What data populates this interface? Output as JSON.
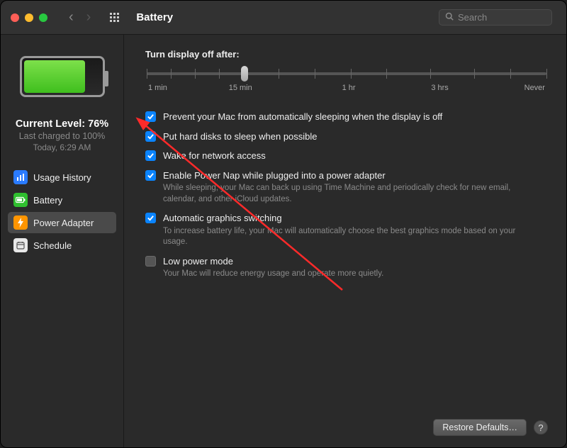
{
  "window": {
    "title": "Battery",
    "search_placeholder": "Search"
  },
  "sidebar": {
    "level_label": "Current Level: 76%",
    "last_charged": "Last charged to 100%",
    "last_time": "Today, 6:29 AM",
    "items": [
      {
        "label": "Usage History",
        "icon": "chart-icon"
      },
      {
        "label": "Battery",
        "icon": "battery-icon"
      },
      {
        "label": "Power Adapter",
        "icon": "bolt-icon"
      },
      {
        "label": "Schedule",
        "icon": "calendar-icon"
      }
    ],
    "selected_index": 2
  },
  "main": {
    "slider_label": "Turn display off after:",
    "slider_ticks": [
      "1 min",
      "15 min",
      "1 hr",
      "3 hrs",
      "Never"
    ],
    "options": [
      {
        "checked": true,
        "label": "Prevent your Mac from automatically sleeping when the display is off",
        "desc": ""
      },
      {
        "checked": true,
        "label": "Put hard disks to sleep when possible",
        "desc": ""
      },
      {
        "checked": true,
        "label": "Wake for network access",
        "desc": ""
      },
      {
        "checked": true,
        "label": "Enable Power Nap while plugged into a power adapter",
        "desc": "While sleeping, your Mac can back up using Time Machine and periodically check for new email, calendar, and other iCloud updates."
      },
      {
        "checked": true,
        "label": "Automatic graphics switching",
        "desc": "To increase battery life, your Mac will automatically choose the best graphics mode based on your usage."
      },
      {
        "checked": false,
        "label": "Low power mode",
        "desc": "Your Mac will reduce energy usage and operate more quietly."
      }
    ]
  },
  "footer": {
    "restore_label": "Restore Defaults…",
    "help_label": "?"
  }
}
